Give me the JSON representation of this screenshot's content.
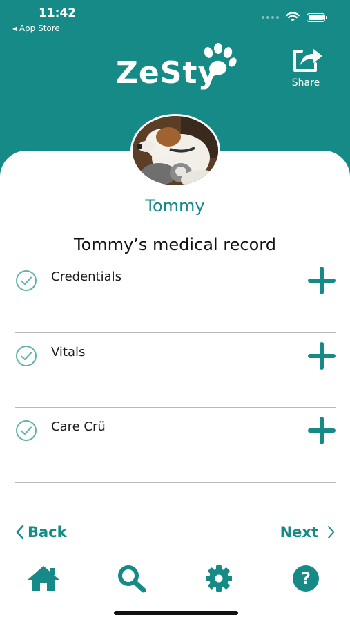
{
  "status_bar": {
    "time": "11:42",
    "back_app": "◂ App Store"
  },
  "header": {
    "logo_text": "ZeSty",
    "share_label": "Share"
  },
  "pet": {
    "name": "Tommy"
  },
  "record": {
    "title": "Tommy’s medical record",
    "sections": [
      {
        "label": "Credentials",
        "icon": "check-circle-icon",
        "action_icon": "plus-icon"
      },
      {
        "label": "Vitals",
        "icon": "check-circle-icon",
        "action_icon": "plus-icon"
      },
      {
        "label": "Care Crü",
        "icon": "check-circle-icon",
        "action_icon": "plus-icon"
      }
    ]
  },
  "navigation": {
    "back_label": "Back",
    "next_label": "Next"
  },
  "tabbar": {
    "items": [
      "home-icon",
      "search-icon",
      "gear-icon",
      "help-icon"
    ]
  },
  "colors": {
    "brand": "#168a86",
    "divider": "#b8b8b8",
    "check": "#5fb3ae"
  }
}
